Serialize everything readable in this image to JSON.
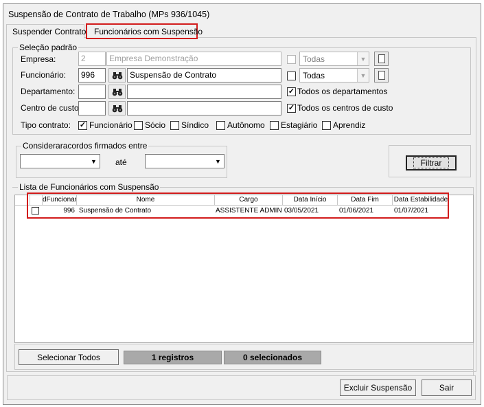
{
  "window": {
    "title": "Suspensão de Contrato de Trabalho (MPs 936/1045)"
  },
  "tabs": [
    {
      "label": "Suspender Contrato",
      "active": true
    },
    {
      "label": "Funcionários com Suspensão",
      "active": false
    }
  ],
  "selecao": {
    "legend": "Seleção padrão",
    "empresa": {
      "label": "Empresa:",
      "code": "2",
      "name": "Empresa Demonstração",
      "all_label": "Todas",
      "all_checked": false,
      "combo": "Todas"
    },
    "funcionario": {
      "label": "Funcionário:",
      "code": "996",
      "name": "Suspensão de Contrato",
      "all_label": "Todas",
      "all_checked": false,
      "combo": "Todas"
    },
    "departamento": {
      "label": "Departamento:",
      "code": "",
      "name": "",
      "all_label": "Todos os departamentos",
      "all_checked": true
    },
    "centro_custo": {
      "label": "Centro de custo:",
      "code": "",
      "name": "",
      "all_label": "Todos os centros de custo",
      "all_checked": true
    },
    "tipo_contrato": {
      "label": "Tipo contrato:",
      "options": [
        {
          "label": "Funcionário",
          "checked": true
        },
        {
          "label": "Sócio",
          "checked": false
        },
        {
          "label": "Síndico",
          "checked": false
        },
        {
          "label": "Autônomo",
          "checked": false
        },
        {
          "label": "Estagiário",
          "checked": false
        },
        {
          "label": "Aprendiz",
          "checked": false
        }
      ]
    }
  },
  "acordos": {
    "legend": "Consideraracordos firmados entre",
    "date_from": "",
    "ate_label": "até",
    "date_to": ""
  },
  "filtrar_label": "Filtrar",
  "lista": {
    "legend": "Lista de Funcionários com Suspensão",
    "columns": [
      "dFuncionari",
      "Nome",
      "Cargo",
      "Data Início",
      "Data Fim",
      "Data Estabilidade"
    ],
    "rows": [
      {
        "checked": false,
        "id": "996",
        "nome": "Suspensão de Contrato",
        "cargo": "ASSISTENTE ADMINIS",
        "inicio": "03/05/2021",
        "fim": "01/06/2021",
        "estabilidade": "01/07/2021"
      }
    ]
  },
  "footer": {
    "selecionar_todos": "Selecionar Todos",
    "registros": "1 registros",
    "selecionados": "0 selecionados"
  },
  "actions": {
    "excluir": "Excluir Suspensão",
    "sair": "Sair"
  },
  "icons": {
    "search": "binoculars-icon",
    "doc": "document-icon",
    "dropdown": "chevron-down-icon"
  },
  "colors": {
    "highlight": "#d21c1c",
    "window_bg": "#f0f0f0"
  }
}
